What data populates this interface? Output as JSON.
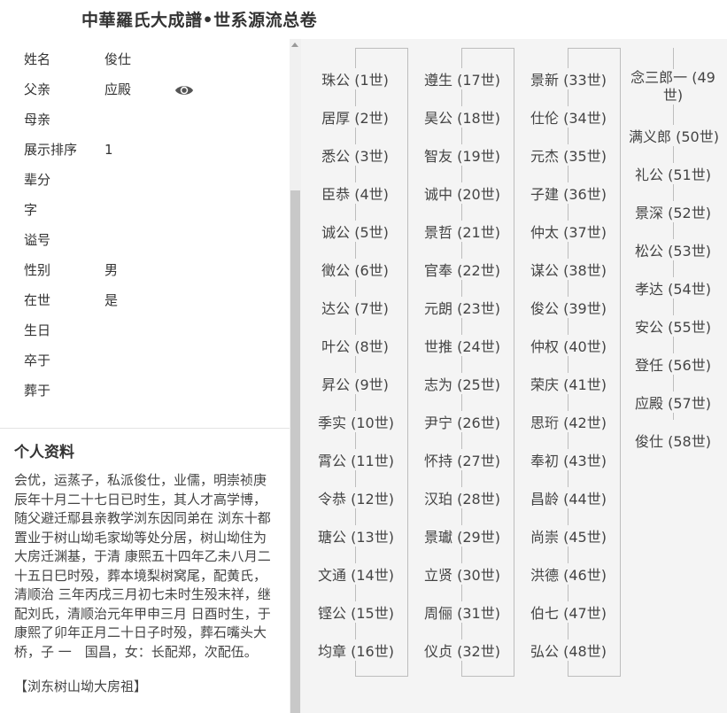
{
  "header": {
    "title": "中華羅氏大成譜•世系源流总卷"
  },
  "profile": {
    "fields": [
      {
        "key": "姓名",
        "value": "俊仕"
      },
      {
        "key": "父亲",
        "value": "应殿"
      },
      {
        "key": "母亲",
        "value": ""
      },
      {
        "key": "展示排序",
        "value": "1"
      },
      {
        "key": "辈分",
        "value": ""
      },
      {
        "key": "字",
        "value": ""
      },
      {
        "key": "谥号",
        "value": ""
      },
      {
        "key": "性别",
        "value": "男"
      },
      {
        "key": "在世",
        "value": "是"
      },
      {
        "key": "生日",
        "value": ""
      },
      {
        "key": "卒于",
        "value": ""
      },
      {
        "key": "葬于",
        "value": ""
      }
    ],
    "father_view_icon": "eye-icon"
  },
  "bio": {
    "title": "个人资料",
    "text": "会优，运蒸子，私派俊仕，业儒，明崇祯庚辰年十月二十七日已时生，其人才高学博，随父避迁鄢县亲教学浏东因同弟在 浏东十都置业于树山坳毛家坳等处分居，树山坳住为大房迁渊基，于清 康熙五十四年乙未八月二十五日巳时殁，葬本境梨树窝尾，配黄氏，清顺治 三年丙戌三月初七未时生殁末祥，继配刘氏，清顺治元年甲申三月 日酉时生，于康熙了卯年正月二十日子时殁，葬石嘴头大桥，子 一　国昌，女：长配郑，次配伍。",
    "source": "【浏东树山坳大房祖】"
  },
  "lineage": {
    "columns": [
      [
        "珠公 (1世)",
        "居厚 (2世)",
        "悉公 (3世)",
        "臣恭 (4世)",
        "诚公 (5世)",
        "徵公 (6世)",
        "达公 (7世)",
        "叶公 (8世)",
        "昇公 (9世)",
        "季实 (10世)",
        "霄公 (11世)",
        "令恭 (12世)",
        "瑭公 (13世)",
        "文通 (14世)",
        "铿公 (15世)",
        "均章 (16世)"
      ],
      [
        "遵生 (17世)",
        "昊公 (18世)",
        "智友 (19世)",
        "诚中 (20世)",
        "景哲 (21世)",
        "官奉 (22世)",
        "元朗 (23世)",
        "世推 (24世)",
        "志为 (25世)",
        "尹宁 (26世)",
        "怀持 (27世)",
        "汉珀 (28世)",
        "景瓛 (29世)",
        "立贤 (30世)",
        "周俪 (31世)",
        "仪贞 (32世)"
      ],
      [
        "景新 (33世)",
        "仕伦 (34世)",
        "元杰 (35世)",
        "子建 (36世)",
        "仲太 (37世)",
        "谋公 (38世)",
        "俊公 (39世)",
        "仲权 (40世)",
        "荣庆 (41世)",
        "思珩 (42世)",
        "奉初 (43世)",
        "昌龄 (44世)",
        "尚崇 (45世)",
        "洪德 (46世)",
        "伯七 (47世)",
        "弘公 (48世)"
      ],
      [
        "念三郎一 (49世)",
        "满义郎 (50世)",
        "礼公 (51世)",
        "景深 (52世)",
        "松公 (53世)",
        "孝达 (54世)",
        "安公 (55世)",
        "登任 (56世)",
        "应殿 (57世)",
        "俊仕 (58世)"
      ]
    ]
  }
}
